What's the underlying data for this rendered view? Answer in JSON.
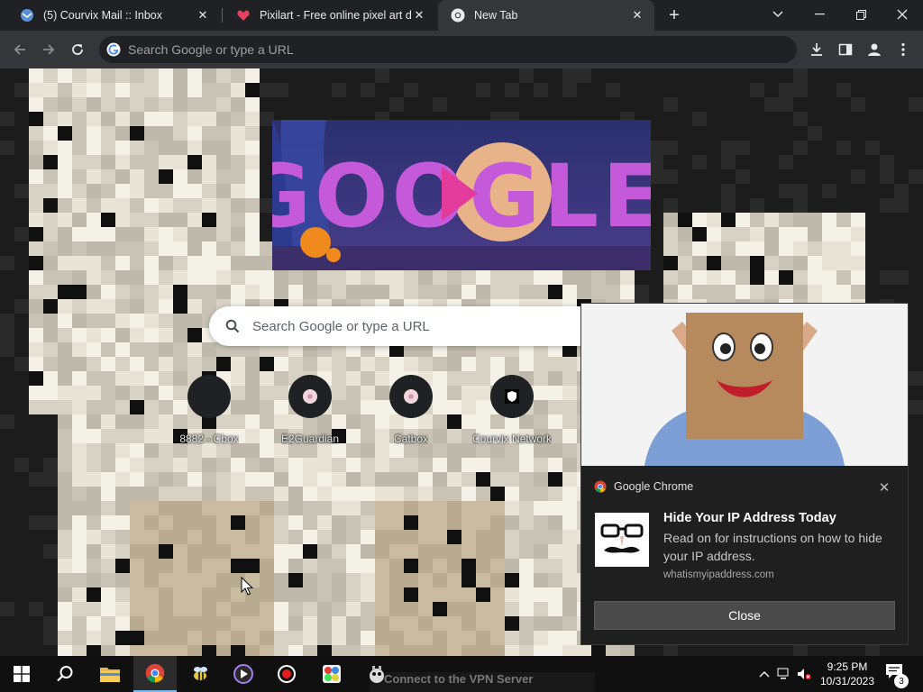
{
  "browser": {
    "tabs": [
      {
        "title": "(5) Courvix Mail :: Inbox",
        "favicon": "courvix-mail-icon",
        "active": false
      },
      {
        "title": "Pixilart - Free online pixel art drawing tool",
        "favicon": "heart-icon",
        "active": false
      },
      {
        "title": "New Tab",
        "favicon": "chrome-icon",
        "active": true
      }
    ],
    "omnibox_placeholder": "Search Google or type a URL"
  },
  "ntp": {
    "doodle_text": "GOOGLE",
    "search_placeholder": "Search Google or type a URL",
    "shortcuts": [
      {
        "label": "8882 - Cbox",
        "icon": "blank-icon"
      },
      {
        "label": "E2Guardian",
        "icon": "flower-icon"
      },
      {
        "label": "Catbox",
        "icon": "flower-icon"
      },
      {
        "label": "Courvix Network",
        "icon": "shield-icon"
      }
    ]
  },
  "notification": {
    "app": "Google Chrome",
    "title": "Hide Your IP Address Today",
    "body": "Read on for instructions on how to hide your IP address.",
    "source": "whatismyipaddress.com",
    "close_label": "Close"
  },
  "taskbar": {
    "snippet": "Connect to the VPN Server",
    "time": "9:25 PM",
    "date": "10/31/2023",
    "notification_count": "3"
  },
  "colors": {
    "accent": "#76b9ed",
    "chrome_dark": "#202124",
    "toolbar": "#35363a"
  }
}
